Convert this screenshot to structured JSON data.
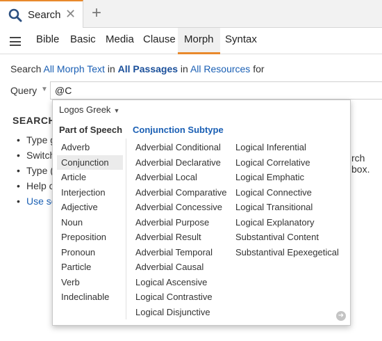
{
  "tab": {
    "title": "Search",
    "close": "✕",
    "new": "+"
  },
  "toolbar": {
    "menu_icon": "hamburger-icon",
    "items": [
      "Bible",
      "Basic",
      "Media",
      "Clause",
      "Morph",
      "Syntax"
    ],
    "active": "Morph"
  },
  "searchline": {
    "prefix": "Search",
    "text_link": "All Morph Text",
    "in1": "in",
    "passages_link": "All Passages",
    "in2": "in",
    "resources_link": "All Resources",
    "suffix": "for"
  },
  "query": {
    "label": "Query",
    "value": "@C"
  },
  "background": {
    "heading": "SEARCH",
    "items": [
      "Type g",
      "Switch",
      "Type (",
      "Help c",
      "Use se"
    ],
    "tail": "rch box."
  },
  "popup": {
    "language": "Logos Greek",
    "pos_header": "Part of Speech",
    "subtype_header": "Conjunction Subtype",
    "pos_items": [
      "Adverb",
      "Conjunction",
      "Article",
      "Interjection",
      "Adjective",
      "Noun",
      "Preposition",
      "Pronoun",
      "Particle",
      "Verb",
      "Indeclinable"
    ],
    "selected_pos": "Conjunction",
    "subtypes_col1": [
      "Adverbial Conditional",
      "Adverbial Declarative",
      "Adverbial Local",
      "Adverbial Comparative",
      "Adverbial Concessive",
      "Adverbial Purpose",
      "Adverbial Result",
      "Adverbial Temporal",
      "Adverbial Causal",
      "Logical Ascensive",
      "Logical Contrastive",
      "Logical Disjunctive"
    ],
    "subtypes_col2": [
      "Logical Inferential",
      "Logical Correlative",
      "Logical Emphatic",
      "Logical Connective",
      "Logical Transitional",
      "Logical Explanatory",
      "Substantival Content",
      "Substantival Epexegetical"
    ]
  },
  "colors": {
    "accent": "#e8892c",
    "link": "#1a5fb4"
  }
}
